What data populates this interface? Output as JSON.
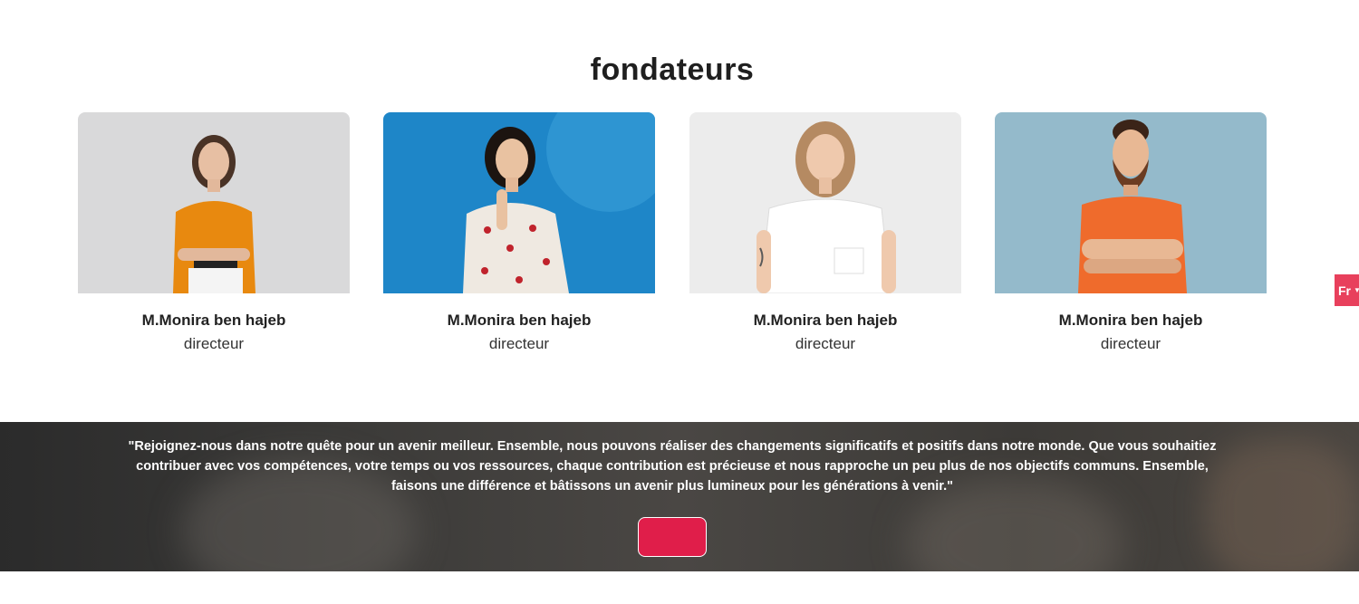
{
  "section": {
    "title": "fondateurs"
  },
  "founders": [
    {
      "name": "M.Monira ben hajeb",
      "role": "directeur",
      "photo_bg": "#d9d9da",
      "shirt": "#e8890f"
    },
    {
      "name": "M.Monira ben hajeb",
      "role": "directeur",
      "photo_bg": "#1e86c8",
      "shirt": "#efe9e1"
    },
    {
      "name": "M.Monira ben hajeb",
      "role": "directeur",
      "photo_bg": "#ececec",
      "shirt": "#ffffff"
    },
    {
      "name": "M.Monira ben hajeb",
      "role": "directeur",
      "photo_bg": "#94bacb",
      "shirt": "#ef6b2c"
    }
  ],
  "language": {
    "current": "Fr"
  },
  "cta": {
    "quote": "\"Rejoignez-nous dans notre quête pour un avenir meilleur. Ensemble, nous pouvons réaliser des changements significatifs et positifs dans notre monde. Que vous souhaitiez contribuer avec vos compétences, votre temps ou vos ressources, chaque contribution est précieuse et nous rapproche un peu plus de nos objectifs communs. Ensemble, faisons une différence et bâtissons un avenir plus lumineux pour les générations à venir.\"",
    "button_label": ""
  },
  "colors": {
    "accent": "#e01e4a",
    "lang_tab": "#e8405c"
  }
}
